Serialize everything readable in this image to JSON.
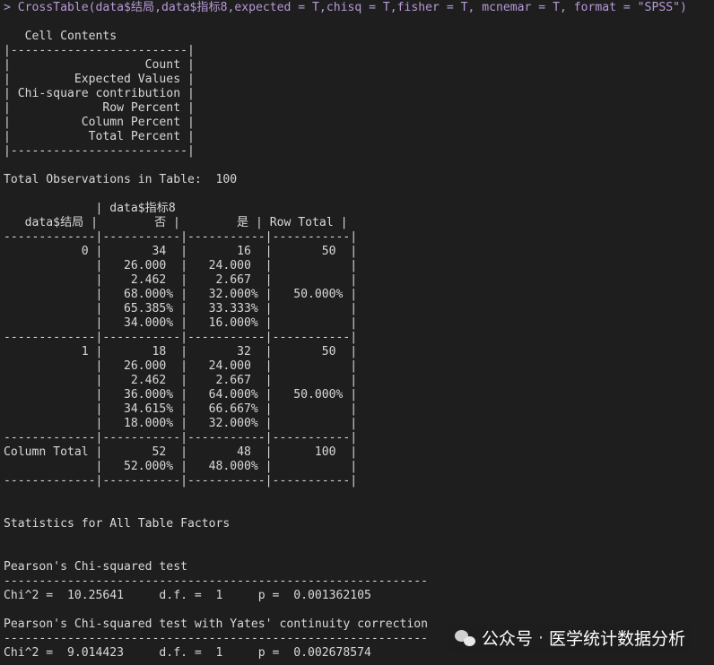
{
  "console": {
    "lines": [
      {
        "text": "> CrossTable(data$结局,data$指标8,expected = T,chisq = T,fisher = T, mcnemar = T, format = \"SPSS\")",
        "kind": "command"
      },
      {
        "text": "",
        "kind": "output"
      },
      {
        "text": "   Cell Contents",
        "kind": "output"
      },
      {
        "text": "|-------------------------|",
        "kind": "output"
      },
      {
        "text": "|                   Count |",
        "kind": "output"
      },
      {
        "text": "|         Expected Values |",
        "kind": "output"
      },
      {
        "text": "| Chi-square contribution |",
        "kind": "output"
      },
      {
        "text": "|             Row Percent |",
        "kind": "output"
      },
      {
        "text": "|          Column Percent |",
        "kind": "output"
      },
      {
        "text": "|           Total Percent |",
        "kind": "output"
      },
      {
        "text": "|-------------------------|",
        "kind": "output"
      },
      {
        "text": "",
        "kind": "output"
      },
      {
        "text": "Total Observations in Table:  100",
        "kind": "output"
      },
      {
        "text": "",
        "kind": "output"
      },
      {
        "text": "             | data$指标8",
        "kind": "output"
      },
      {
        "text": "   data$结局 |        否 |        是 | Row Total |",
        "kind": "output"
      },
      {
        "text": "-------------|-----------|-----------|-----------|",
        "kind": "output"
      },
      {
        "text": "           0 |       34  |       16  |       50  |",
        "kind": "output"
      },
      {
        "text": "             |   26.000  |   24.000  |           |",
        "kind": "output"
      },
      {
        "text": "             |    2.462  |    2.667  |           |",
        "kind": "output"
      },
      {
        "text": "             |   68.000% |   32.000% |   50.000% |",
        "kind": "output"
      },
      {
        "text": "             |   65.385% |   33.333% |           |",
        "kind": "output"
      },
      {
        "text": "             |   34.000% |   16.000% |           |",
        "kind": "output"
      },
      {
        "text": "-------------|-----------|-----------|-----------|",
        "kind": "output"
      },
      {
        "text": "           1 |       18  |       32  |       50  |",
        "kind": "output"
      },
      {
        "text": "             |   26.000  |   24.000  |           |",
        "kind": "output"
      },
      {
        "text": "             |    2.462  |    2.667  |           |",
        "kind": "output"
      },
      {
        "text": "             |   36.000% |   64.000% |   50.000% |",
        "kind": "output"
      },
      {
        "text": "             |   34.615% |   66.667% |           |",
        "kind": "output"
      },
      {
        "text": "             |   18.000% |   32.000% |           |",
        "kind": "output"
      },
      {
        "text": "-------------|-----------|-----------|-----------|",
        "kind": "output"
      },
      {
        "text": "Column Total |       52  |       48  |      100  |",
        "kind": "output"
      },
      {
        "text": "             |   52.000% |   48.000% |           |",
        "kind": "output"
      },
      {
        "text": "-------------|-----------|-----------|-----------|",
        "kind": "output"
      },
      {
        "text": "",
        "kind": "output"
      },
      {
        "text": "",
        "kind": "output"
      },
      {
        "text": "Statistics for All Table Factors",
        "kind": "output"
      },
      {
        "text": "",
        "kind": "output"
      },
      {
        "text": "",
        "kind": "output"
      },
      {
        "text": "Pearson's Chi-squared test",
        "kind": "output"
      },
      {
        "text": "------------------------------------------------------------",
        "kind": "output"
      },
      {
        "text": "Chi^2 =  10.25641     d.f. =  1     p =  0.001362105",
        "kind": "output"
      },
      {
        "text": "",
        "kind": "output"
      },
      {
        "text": "Pearson's Chi-squared test with Yates' continuity correction",
        "kind": "output"
      },
      {
        "text": "------------------------------------------------------------",
        "kind": "output"
      },
      {
        "text": "Chi^2 =  9.014423     d.f. =  1     p =  0.002678574",
        "kind": "output"
      }
    ]
  },
  "watermark": {
    "logo_icon": "wechat-icon",
    "account_prefix": "公众号",
    "separator": "·",
    "account_name": "医学统计数据分析"
  },
  "colors": {
    "background": "#1e1e1e",
    "output_text": "#d9d9d9",
    "command_text": "#b79ad8"
  }
}
